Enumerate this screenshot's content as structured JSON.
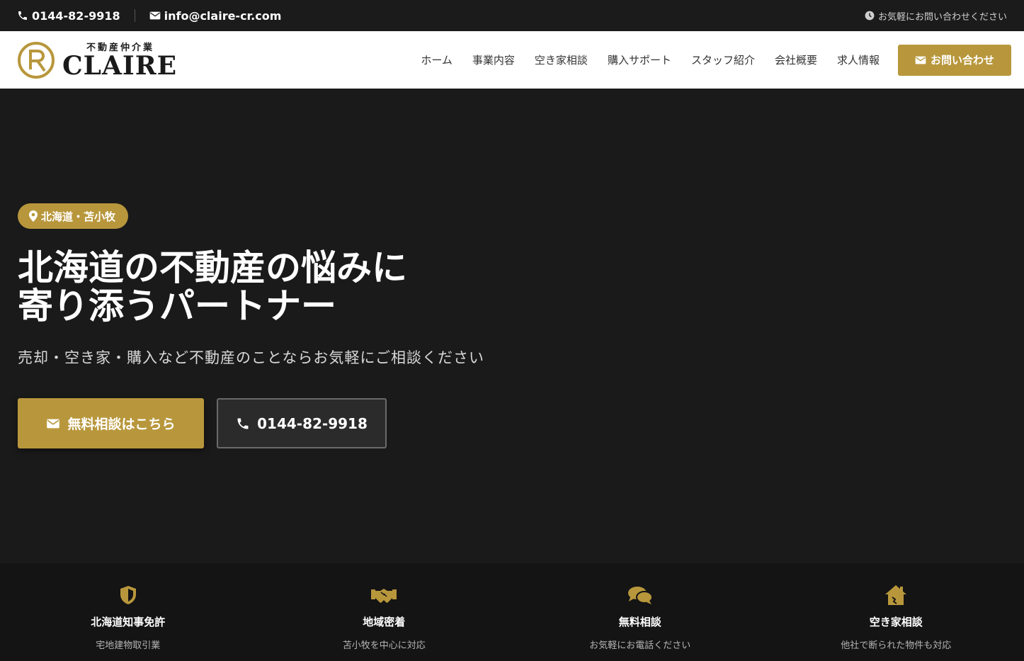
{
  "topbar": {
    "phone": "0144-82-9918",
    "email": "info@claire-cr.com",
    "notice": "お気軽にお問い合わせください"
  },
  "header": {
    "logo_sub": "不動産仲介業",
    "logo_main": "CLAIRE",
    "nav": [
      "ホーム",
      "事業内容",
      "空き家相談",
      "購入サポート",
      "スタッフ紹介",
      "会社概要",
      "求人情報"
    ],
    "cta_label": "お問い合わせ"
  },
  "hero": {
    "badge": "北海道・苫小牧",
    "title_line1": "北海道の不動産の悩みに",
    "title_line2": "寄り添うパートナー",
    "subtitle": "売却・空き家・購入など不動産のことならお気軽にご相談ください",
    "primary_button": "無料相談はこちら",
    "secondary_button": "0144-82-9918"
  },
  "features": [
    {
      "icon": "shield-icon",
      "title": "北海道知事免許",
      "desc": "宅地建物取引業"
    },
    {
      "icon": "handshake-icon",
      "title": "地域密着",
      "desc": "苫小牧を中心に対応"
    },
    {
      "icon": "chat-icon",
      "title": "無料相談",
      "desc": "お気軽にお電話ください"
    },
    {
      "icon": "house-icon",
      "title": "空き家相談",
      "desc": "他社で断られた物件も対応"
    }
  ],
  "colors": {
    "accent": "#b8973c",
    "dark": "#1a1a1a",
    "features_bg": "#141414"
  }
}
